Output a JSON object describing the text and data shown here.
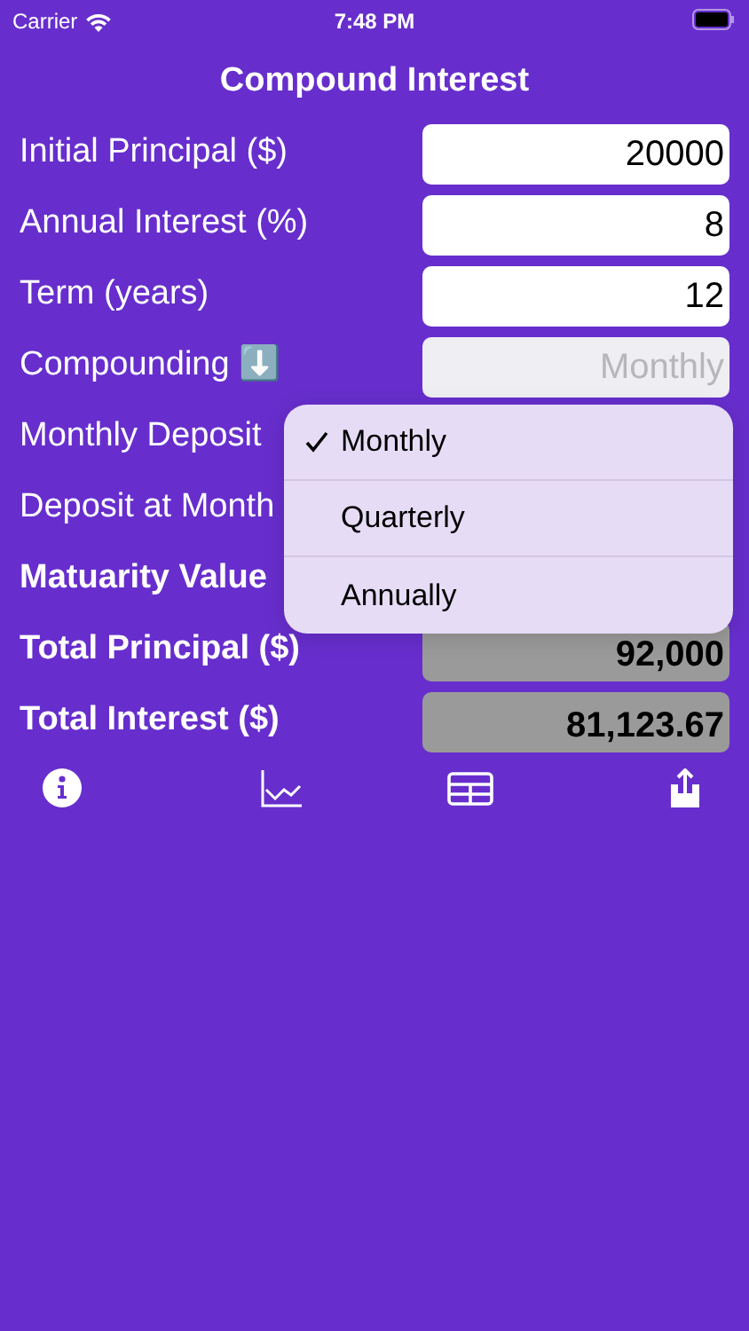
{
  "status_bar": {
    "carrier": "Carrier",
    "time": "7:48 PM"
  },
  "title": "Compound Interest",
  "rows": [
    {
      "label": "Initial Principal ($)",
      "kind": "input",
      "value": "20000"
    },
    {
      "label": "Annual Interest (%)",
      "kind": "input",
      "value": "8"
    },
    {
      "label": "Term (years)",
      "kind": "input",
      "value": "12"
    },
    {
      "label": "Compounding ⬇️",
      "kind": "select",
      "value": "Monthly"
    },
    {
      "label": "Monthly Deposit",
      "kind": "hidden"
    },
    {
      "label": "Deposit at Month",
      "kind": "hidden"
    },
    {
      "label": "Matuarity Value",
      "kind": "hidden",
      "bold": true
    },
    {
      "label": "Total Principal ($)",
      "kind": "output",
      "value": "92,000",
      "bold": true
    },
    {
      "label": "Total Interest ($)",
      "kind": "output",
      "value": "81,123.67",
      "bold": true
    }
  ],
  "menu": [
    {
      "label": "Monthly",
      "selected": true
    },
    {
      "label": "Quarterly",
      "selected": false
    },
    {
      "label": "Annually",
      "selected": false
    }
  ],
  "toolbar": [
    {
      "kind": "info"
    },
    {
      "kind": "chart"
    },
    {
      "kind": "table"
    },
    {
      "kind": "share"
    }
  ]
}
